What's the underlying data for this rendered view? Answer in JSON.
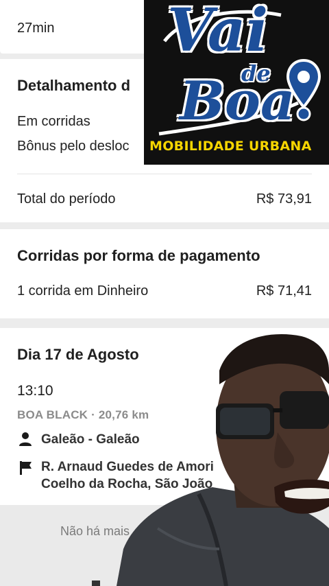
{
  "top_card": {
    "duration": "27min"
  },
  "breakdown": {
    "heading": "Detalhamento d",
    "rows": [
      {
        "label": "Em corridas"
      },
      {
        "label": "Bônus pelo desloc"
      }
    ],
    "total": {
      "label": "Total do período",
      "value": "R$ 73,91"
    }
  },
  "payment": {
    "heading": "Corridas por forma de pagamento",
    "row": {
      "label": "1 corrida em Dinheiro",
      "value": "R$ 71,41"
    }
  },
  "day": {
    "heading": "Dia 17 de Agosto",
    "ride": {
      "time": "13:10",
      "meta": "BOA BLACK · 20,76 km",
      "pickup": "Galeão - Galeão",
      "dropoff_line1": "R. Arnaud Guedes de Amori",
      "dropoff_line2": "Coelho da Rocha, São João"
    }
  },
  "footer": {
    "no_more": "Não há mais"
  },
  "logo": {
    "word1": "Vai",
    "word2": "de",
    "word3": "Boa",
    "tagline": "MOBILIDADE URBANA",
    "colors": {
      "blue": "#1d4f9a",
      "yellow": "#f6d500",
      "bg": "#101010"
    }
  },
  "icons": {
    "person": "person-icon",
    "flag": "flag-icon",
    "pin": "location-pin-icon"
  }
}
